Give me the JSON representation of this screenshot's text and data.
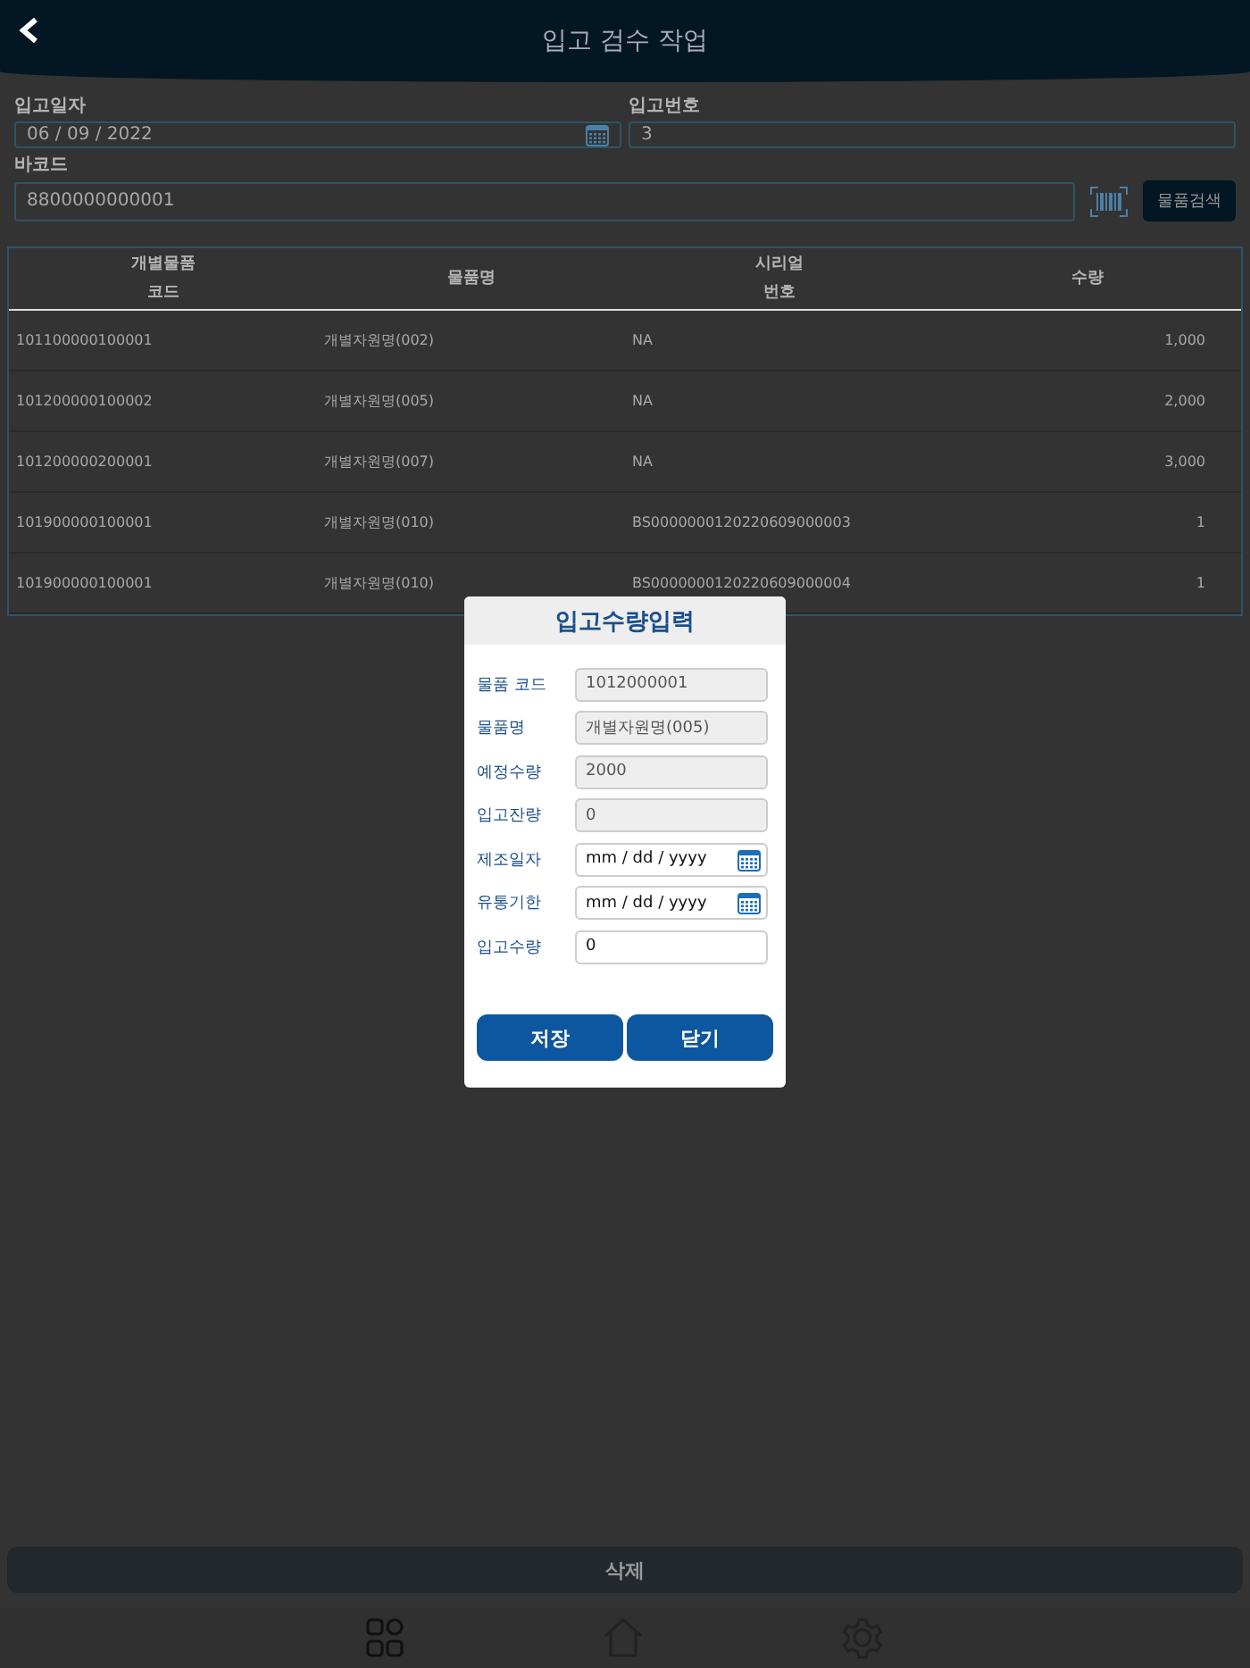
{
  "header": {
    "title": "입고 검수 작업"
  },
  "form": {
    "date_label": "입고일자",
    "date_value": "06 / 09 / 2022",
    "number_label": "입고번호",
    "number_value": "3",
    "barcode_label": "바코드",
    "barcode_value": "8800000000001",
    "search_button": "물품검색"
  },
  "table": {
    "columns": [
      {
        "lines": [
          "개별물품",
          "코드"
        ]
      },
      {
        "lines": [
          "물품명"
        ]
      },
      {
        "lines": [
          "시리얼",
          "번호"
        ]
      },
      {
        "lines": [
          "수량"
        ]
      }
    ],
    "rows": [
      [
        "101100000100001",
        "개별자원명(002)",
        "NA",
        "1,000"
      ],
      [
        "101200000100002",
        "개별자원명(005)",
        "NA",
        "2,000"
      ],
      [
        "101200000200001",
        "개별자원명(007)",
        "NA",
        "3,000"
      ],
      [
        "101900000100001",
        "개별자원명(010)",
        "BS0000000120220609000003",
        "1"
      ],
      [
        "101900000100001",
        "개별자원명(010)",
        "BS0000000120220609000004",
        "1"
      ]
    ]
  },
  "delete_button": "삭제",
  "dialog": {
    "title": "입고수량입력",
    "fields": [
      {
        "label": "물품 코드",
        "value": "1012000001",
        "kind": "text",
        "disabled": true
      },
      {
        "label": "물품명",
        "value": "개별자원명(005)",
        "kind": "text",
        "disabled": true
      },
      {
        "label": "예정수량",
        "value": "2000",
        "kind": "text",
        "disabled": true
      },
      {
        "label": "입고잔량",
        "value": "0",
        "kind": "text",
        "disabled": true
      },
      {
        "label": "제조일자",
        "value": "mm / dd / yyyy",
        "kind": "date",
        "disabled": false
      },
      {
        "label": "유통기한",
        "value": "mm / dd / yyyy",
        "kind": "date",
        "disabled": false
      },
      {
        "label": "입고수량",
        "value": "0",
        "kind": "text",
        "disabled": false
      }
    ],
    "buttons": [
      "저장",
      "닫기"
    ]
  }
}
